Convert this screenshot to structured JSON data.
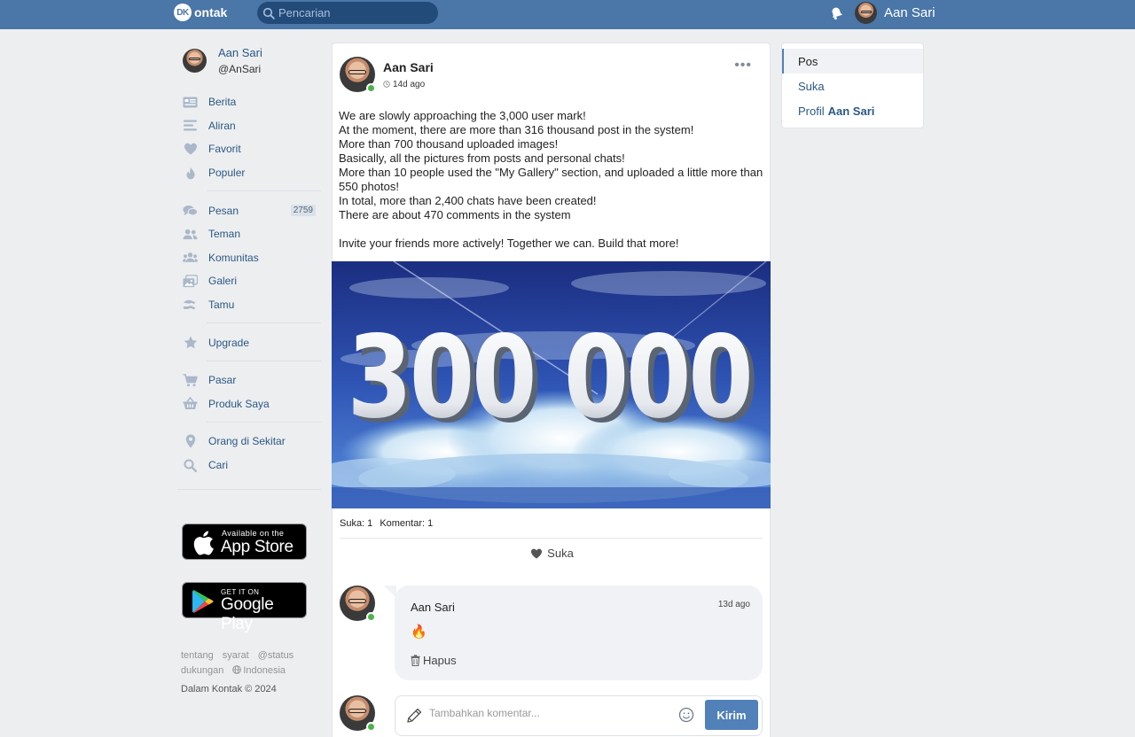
{
  "header": {
    "logo_badge": "DK",
    "logo_text": "ontak",
    "search_placeholder": "Pencarian",
    "user_name": "Aan Sari"
  },
  "sidebar": {
    "profile": {
      "name": "Aan Sari",
      "handle": "@AnSari"
    },
    "groups": [
      [
        {
          "label": "Berita",
          "icon": "news-icon"
        },
        {
          "label": "Aliran",
          "icon": "feed-icon"
        },
        {
          "label": "Favorit",
          "icon": "heart-icon"
        },
        {
          "label": "Populer",
          "icon": "flame-icon"
        }
      ],
      [
        {
          "label": "Pesan",
          "icon": "messages-icon",
          "count": "2759"
        },
        {
          "label": "Teman",
          "icon": "friends-icon"
        },
        {
          "label": "Komunitas",
          "icon": "communities-icon"
        },
        {
          "label": "Galeri",
          "icon": "gallery-icon"
        },
        {
          "label": "Tamu",
          "icon": "guests-icon"
        }
      ],
      [
        {
          "label": "Upgrade",
          "icon": "star-icon"
        }
      ],
      [
        {
          "label": "Pasar",
          "icon": "cart-icon"
        },
        {
          "label": "Produk Saya",
          "icon": "basket-icon"
        }
      ],
      [
        {
          "label": "Orang di Sekitar",
          "icon": "location-pin-icon"
        },
        {
          "label": "Cari",
          "icon": "search-icon"
        }
      ]
    ],
    "app_store": {
      "small": "Available on the",
      "big": "App Store"
    },
    "google_play": {
      "small": "GET IT ON",
      "big": "Google Play"
    },
    "footer_links": [
      "tentang",
      "syarat",
      "@status",
      "dukungan"
    ],
    "language": "Indonesia",
    "copyright": "Dalam Kontak © 2024"
  },
  "post": {
    "author": "Aan Sari",
    "time": "14d ago",
    "more": "•••",
    "paragraphs": [
      "We are slowly approaching the 3,000 user mark!\nAt the moment, there are more than 316 thousand post in the system!\nMore than 700 thousand uploaded images!\nBasically, all the pictures from posts and personal chats!\nMore than 10 people used the \"My Gallery\" section, and uploaded a little more than 550 photos!\nIn total, more than 2,400 chats have been created!\nThere are about 470 comments in the system",
      "Invite your friends more actively! Together we can. Build that more!"
    ],
    "image_text": "300 000",
    "likes_label": "Suka: 1",
    "comments_label": "Komentar: 1",
    "like_button": "Suka"
  },
  "comment": {
    "author": "Aan Sari",
    "time": "13d ago",
    "body": "🔥",
    "delete_label": "Hapus"
  },
  "composer": {
    "placeholder": "Tambahkan komentar...",
    "send_label": "Kirim"
  },
  "tabs": {
    "items": [
      "Pos",
      "Suka"
    ],
    "profile_prefix": "Profil",
    "profile_name": "Aan Sari",
    "active_index": 0
  },
  "colors": {
    "header": "#4a76a8",
    "link": "#2a5885",
    "accent_button": "#5181b8",
    "online": "#4bb34b"
  }
}
